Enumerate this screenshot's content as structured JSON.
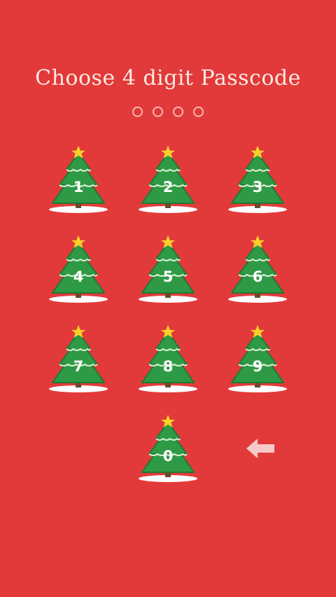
{
  "title": "Choose 4 digit Passcode",
  "passcode_length": 4,
  "keys": [
    {
      "digit": "1",
      "label": "1"
    },
    {
      "digit": "2",
      "label": "2"
    },
    {
      "digit": "3",
      "label": "3"
    },
    {
      "digit": "4",
      "label": "4"
    },
    {
      "digit": "5",
      "label": "5"
    },
    {
      "digit": "6",
      "label": "6"
    },
    {
      "digit": "7",
      "label": "7"
    },
    {
      "digit": "8",
      "label": "8"
    },
    {
      "digit": "9",
      "label": "9"
    },
    {
      "digit": "0",
      "label": "0"
    }
  ],
  "backspace_icon": "arrow-left-icon",
  "key_icon": "christmas-tree-icon",
  "colors": {
    "background": "#e23a3a",
    "title_text": "#fbe9e3",
    "dot_outline": "#f7b8b0",
    "tree_green": "#2f9a46",
    "tree_dark": "#1f7a33",
    "trunk": "#6b4a2b",
    "star": "#f6d02a",
    "snow": "#ffffff",
    "arrow": "#f8c9c9"
  }
}
